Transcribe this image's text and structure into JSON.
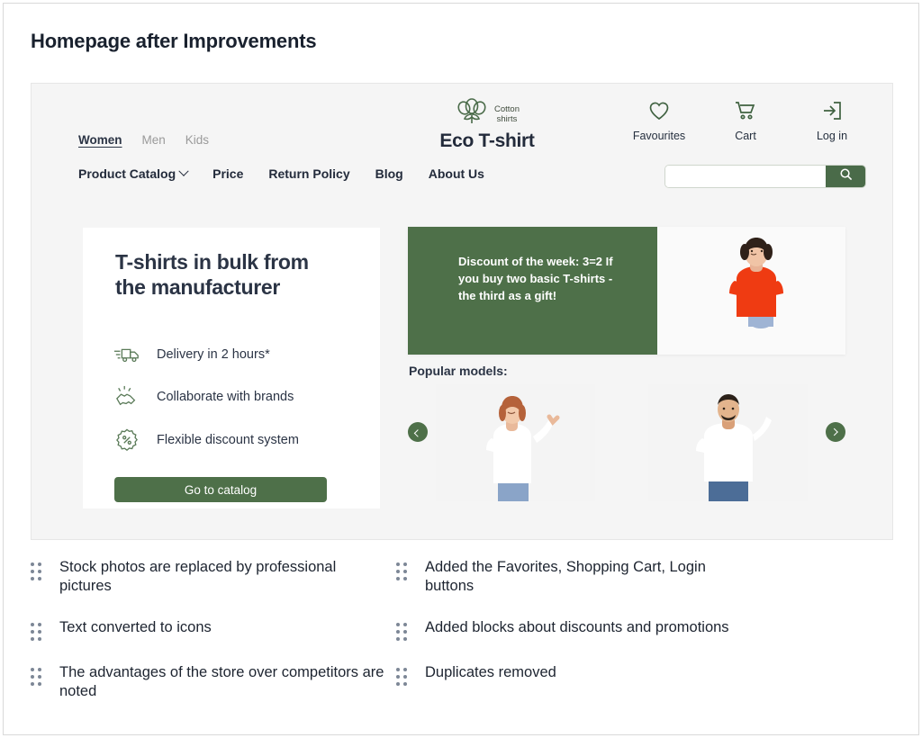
{
  "slide": {
    "title": "Homepage after Improvements"
  },
  "site": {
    "category_nav": [
      {
        "label": "Women",
        "active": true
      },
      {
        "label": "Men",
        "active": false
      },
      {
        "label": "Kids",
        "active": false
      }
    ],
    "main_nav": [
      {
        "label": "Product Catalog",
        "has_dropdown": true
      },
      {
        "label": "Price",
        "has_dropdown": false
      },
      {
        "label": "Return Policy",
        "has_dropdown": false
      },
      {
        "label": "Blog",
        "has_dropdown": false
      },
      {
        "label": "About Us",
        "has_dropdown": false
      }
    ],
    "logo": {
      "name": "Eco T-shirt",
      "tagline_line1": "Cotton",
      "tagline_line2": "shirts",
      "icon": "cotton-plant-icon"
    },
    "account": [
      {
        "label": "Favourites",
        "icon": "heart-icon"
      },
      {
        "label": "Cart",
        "icon": "shopping-cart-icon"
      },
      {
        "label": "Log in",
        "icon": "login-arrow-icon"
      }
    ],
    "search": {
      "value": "",
      "placeholder": "",
      "icon": "search-icon"
    },
    "hero": {
      "heading": "T-shirts in bulk from the manufacturer",
      "features": [
        {
          "icon": "delivery-truck-icon",
          "label": "Delivery in 2 hours*"
        },
        {
          "icon": "handshake-icon",
          "label": "Collaborate with brands"
        },
        {
          "icon": "percent-badge-icon",
          "label": "Flexible discount system"
        }
      ],
      "cta_label": "Go to catalog"
    },
    "banner": {
      "text": "Discount of the week: 3=2 If you buy two basic T-shirts - the third as a gift!",
      "photo_alt": "woman-in-red-tshirt"
    },
    "popular": {
      "title": "Popular models:",
      "slides": [
        {
          "alt": "woman-in-white-tshirt"
        },
        {
          "alt": "man-in-white-tshirt"
        }
      ],
      "prev_icon": "chevron-left-icon",
      "next_icon": "chevron-right-icon"
    }
  },
  "improvements": {
    "left": [
      "Stock photos are replaced by professional pictures",
      "Text converted to icons",
      "The advantages of the store over competitors are noted"
    ],
    "right": [
      "Added the Favorites, Shopping Cart, Login buttons",
      "Added blocks about discounts and promotions",
      "Duplicates removed"
    ]
  },
  "colors": {
    "brand_green": "#4e7049",
    "dark_text": "#2b3445",
    "panel_bg": "#f5f5f5",
    "accent_red": "#ef3b12"
  }
}
